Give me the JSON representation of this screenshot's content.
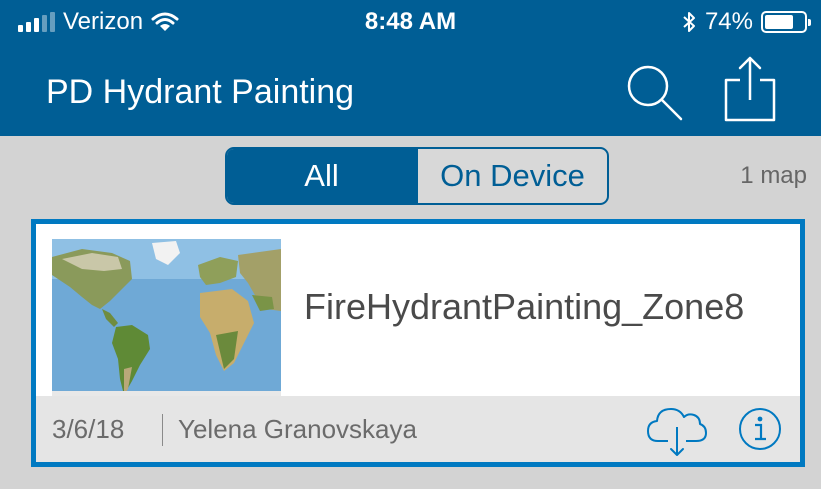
{
  "status_bar": {
    "carrier": "Verizon",
    "time": "8:48 AM",
    "battery_percent": "74%",
    "battery_level": 0.74,
    "icons": [
      "signal-icon",
      "wifi-icon",
      "bluetooth-icon",
      "battery-icon"
    ]
  },
  "nav": {
    "title": "PD Hydrant Painting",
    "icons": [
      "search-icon",
      "share-icon"
    ]
  },
  "filter": {
    "options": [
      {
        "label": "All",
        "selected": true
      },
      {
        "label": "On Device",
        "selected": false
      }
    ],
    "count_text": "1 map"
  },
  "maps": [
    {
      "title": "FireHydrantPainting_Zone8",
      "date": "3/6/18",
      "author": "Yelena Granovskaya",
      "icons": [
        "download-cloud-icon",
        "info-icon"
      ]
    }
  ],
  "colors": {
    "brand": "#005e95",
    "accent": "#0079c1",
    "background": "#d3d3d3"
  }
}
